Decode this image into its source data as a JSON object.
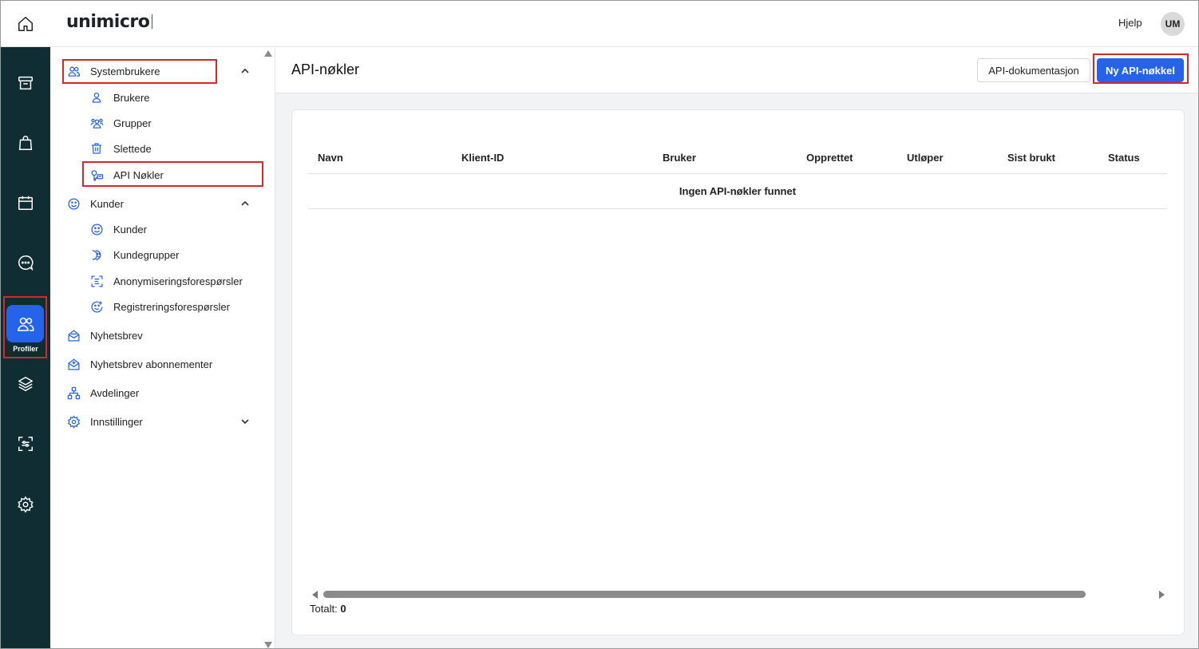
{
  "header": {
    "logo_text": "unimicro",
    "help_label": "Hjelp",
    "avatar_initials": "UM"
  },
  "rail": {
    "items": [
      {
        "icon": "home-icon"
      },
      {
        "icon": "archive-icon"
      },
      {
        "icon": "shopping-bag-icon"
      },
      {
        "icon": "calendar-icon"
      },
      {
        "icon": "chat-icon"
      },
      {
        "icon": "users-icon",
        "label": "Profiler",
        "active": true
      },
      {
        "icon": "layers-icon"
      },
      {
        "icon": "scan-settings-icon"
      },
      {
        "icon": "gear-icon"
      }
    ]
  },
  "sidenav": {
    "systembrukere": {
      "label": "Systembrukere",
      "expanded": true
    },
    "systembrukere_items": [
      {
        "label": "Brukere",
        "icon": "user-icon"
      },
      {
        "label": "Grupper",
        "icon": "group-icon"
      },
      {
        "label": "Slettede",
        "icon": "trash-icon"
      },
      {
        "label": "API Nøkler",
        "icon": "key-icon",
        "selected": true
      }
    ],
    "kunder": {
      "label": "Kunder",
      "expanded": true
    },
    "kunder_items": [
      {
        "label": "Kunder",
        "icon": "smiley-icon"
      },
      {
        "label": "Kundegrupper",
        "icon": "customer-group-icon"
      },
      {
        "label": "Anonymiseringsforespørsler",
        "icon": "anonymize-icon"
      },
      {
        "label": "Registreringsforespørsler",
        "icon": "registration-icon"
      }
    ],
    "nyhetsbrev": {
      "label": "Nyhetsbrev"
    },
    "nyhetsbrev_abonnementer": {
      "label": "Nyhetsbrev abonnementer"
    },
    "avdelinger": {
      "label": "Avdelinger"
    },
    "innstillinger": {
      "label": "Innstillinger",
      "expanded": false
    }
  },
  "main": {
    "title": "API-nøkler",
    "docs_button": "API-dokumentasjon",
    "new_button": "Ny API-nøkkel",
    "table": {
      "columns": [
        "Navn",
        "Klient-ID",
        "Bruker",
        "Opprettet",
        "Utløper",
        "Sist brukt",
        "Status"
      ],
      "rows": [],
      "empty_text": "Ingen API-nøkler funnet"
    },
    "total_label": "Totalt:",
    "total_value": "0"
  },
  "colors": {
    "rail_bg": "#0f2d33",
    "accent": "#2563eb",
    "highlight": "#d62828"
  }
}
